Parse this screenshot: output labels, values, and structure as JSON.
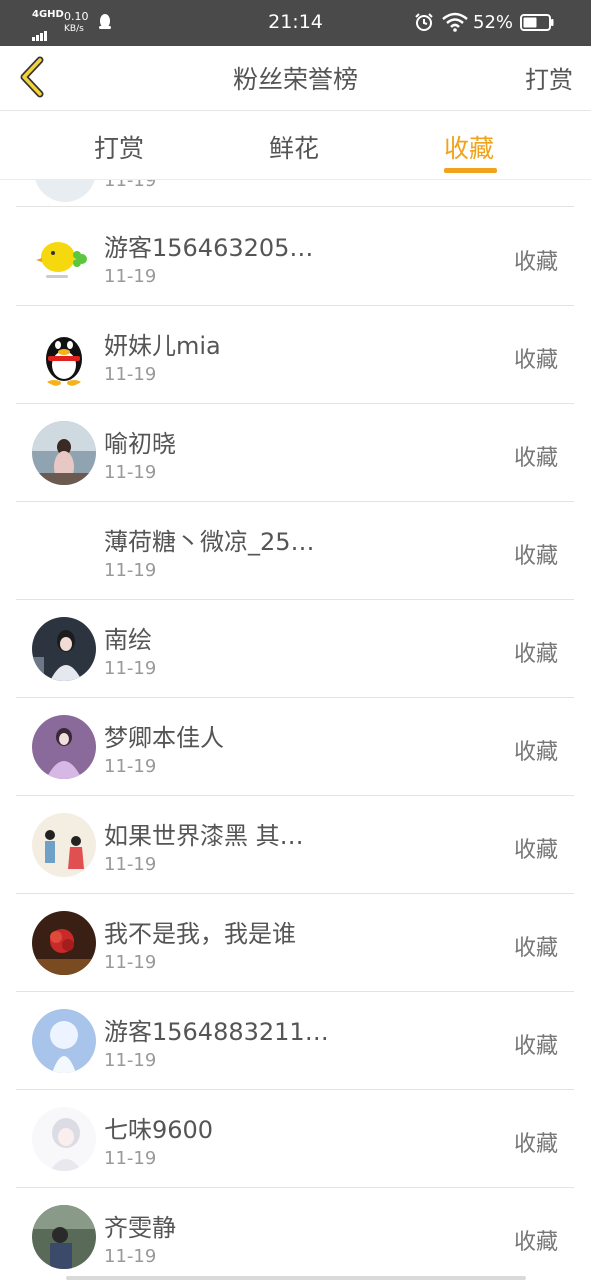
{
  "status_bar": {
    "network": "4GHD",
    "speed_value": "0.10",
    "speed_unit": "KB/s",
    "time": "21:14",
    "battery": "52%"
  },
  "header": {
    "title": "粉丝荣誉榜",
    "right_label": "打赏"
  },
  "tabs": [
    {
      "label": "打赏",
      "active": false
    },
    {
      "label": "鲜花",
      "active": false
    },
    {
      "label": "收藏",
      "active": true
    }
  ],
  "colors": {
    "accent": "#f0a31b",
    "statusbar": "#4a4a4a"
  },
  "partial_row": {
    "date": "11-19"
  },
  "rows": [
    {
      "name": "游客156463205…",
      "date": "11-19",
      "action": "收藏",
      "avatar": "chick-avatar"
    },
    {
      "name": "妍妹儿mia",
      "date": "11-19",
      "action": "收藏",
      "avatar": "penguin-avatar"
    },
    {
      "name": "喻初晓",
      "date": "11-19",
      "action": "收藏",
      "avatar": "photo-avatar"
    },
    {
      "name": "薄荷糖丶微凉_25…",
      "date": "11-19",
      "action": "收藏",
      "avatar": "blank-avatar"
    },
    {
      "name": "南绘",
      "date": "11-19",
      "action": "收藏",
      "avatar": "photo-avatar"
    },
    {
      "name": "梦卿本佳人",
      "date": "11-19",
      "action": "收藏",
      "avatar": "photo-avatar"
    },
    {
      "name": "如果世界漆黑 其…",
      "date": "11-19",
      "action": "收藏",
      "avatar": "illustration-avatar"
    },
    {
      "name": "我不是我，我是谁",
      "date": "11-19",
      "action": "收藏",
      "avatar": "photo-avatar"
    },
    {
      "name": "游客1564883211…",
      "date": "11-19",
      "action": "收藏",
      "avatar": "photo-avatar"
    },
    {
      "name": "七味9600",
      "date": "11-19",
      "action": "收藏",
      "avatar": "illustration-avatar"
    },
    {
      "name": "齐雯静",
      "date": "11-19",
      "action": "收藏",
      "avatar": "photo-avatar"
    }
  ]
}
